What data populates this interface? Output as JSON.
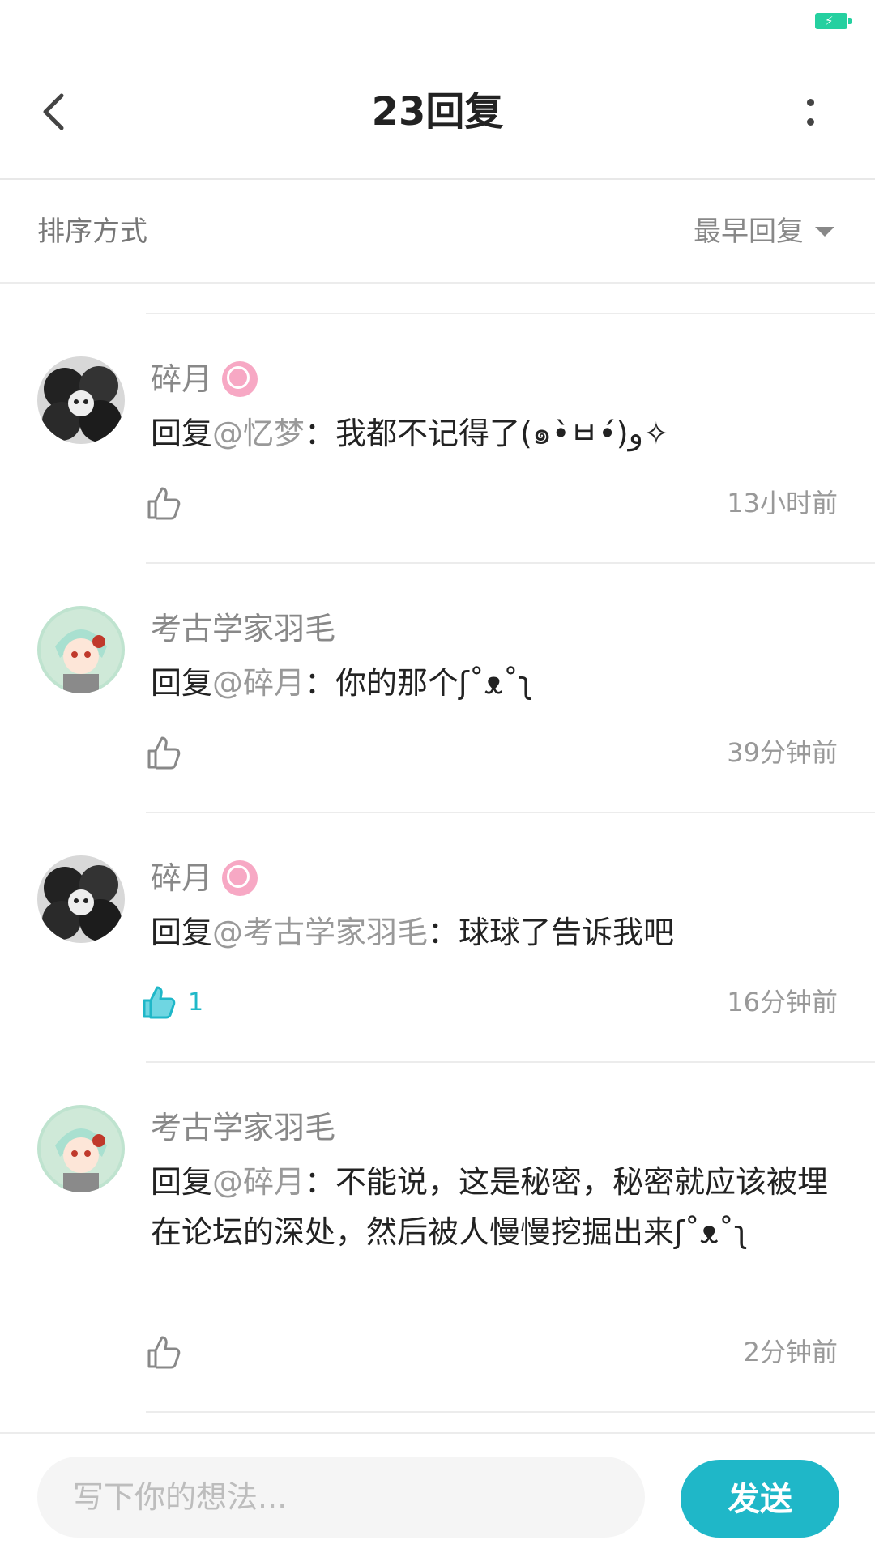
{
  "status_bar": {
    "battery_color": "#25d0a0"
  },
  "header": {
    "title": "23回复",
    "back_icon": "chevron-left-icon",
    "more_icon": "vertical-dots-icon"
  },
  "sort": {
    "label": "排序方式",
    "selected": "最早回复"
  },
  "comments": [
    {
      "user": "碎月",
      "has_badge": true,
      "reply_prefix": "回复",
      "mention": "@忆梦",
      "text": "：我都不记得了(๑•̀ㅂ•́)و✧",
      "likes": "",
      "liked": false,
      "time": "13小时前"
    },
    {
      "user": "考古学家羽毛",
      "has_badge": false,
      "reply_prefix": "回复",
      "mention": "@碎月",
      "text": "：你的那个ʃ˚ᴥ˚ʅ",
      "likes": "",
      "liked": false,
      "time": "39分钟前"
    },
    {
      "user": "碎月",
      "has_badge": true,
      "reply_prefix": "回复",
      "mention": "@考古学家羽毛",
      "text": "：球球了告诉我吧",
      "likes": "1",
      "liked": true,
      "time": "16分钟前"
    },
    {
      "user": "考古学家羽毛",
      "has_badge": false,
      "reply_prefix": "回复",
      "mention": "@碎月",
      "text": "：不能说，这是秘密，秘密就应该被埋在论坛的深处，然后被人慢慢挖掘出来ʃ˚ᴥ˚ʅ",
      "likes": "",
      "liked": false,
      "time": "2分钟前"
    }
  ],
  "composer": {
    "placeholder": "写下你的想法...",
    "send_label": "发送"
  },
  "colors": {
    "accent": "#1fb7c8",
    "text_primary": "#222222",
    "text_secondary": "#999999"
  }
}
